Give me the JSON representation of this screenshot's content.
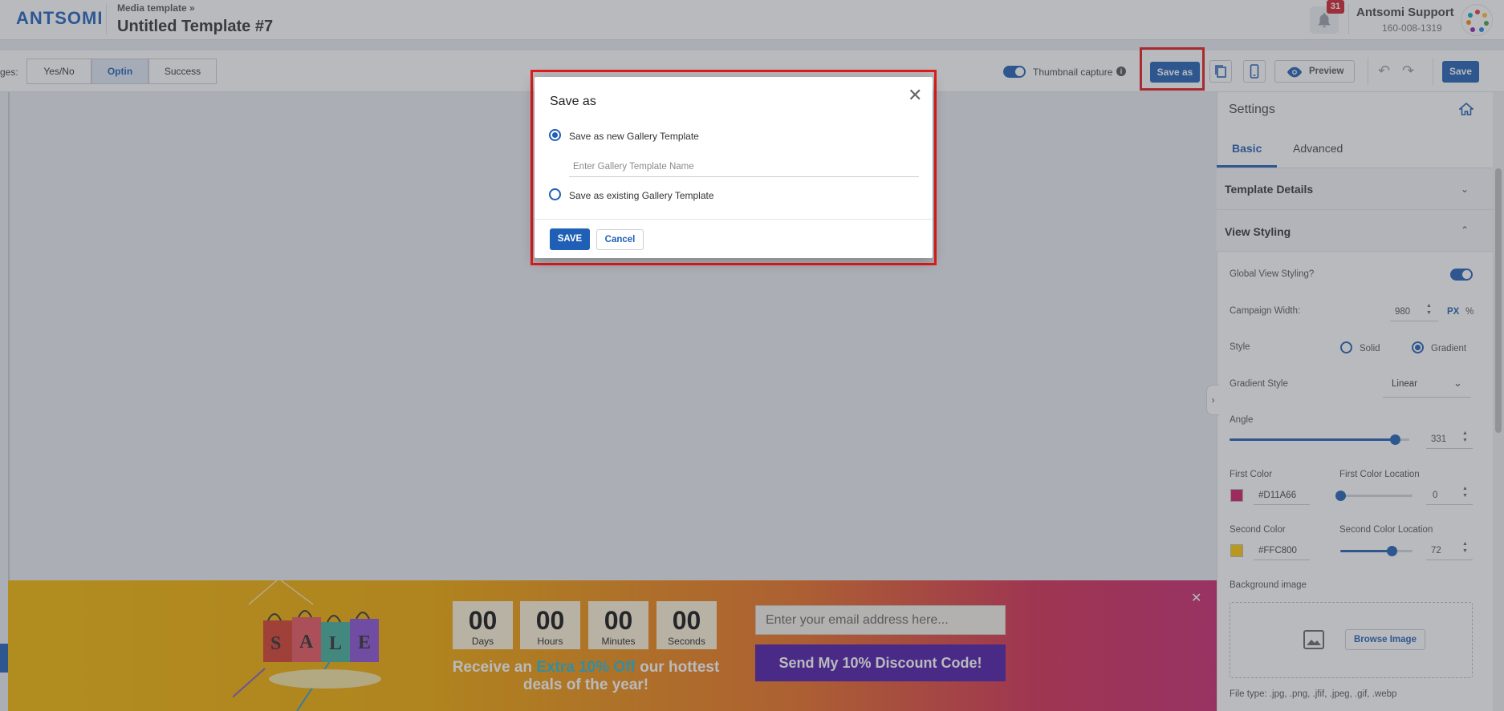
{
  "header": {
    "logo": "ANTSOMI",
    "breadcrumb": "Media template »",
    "title": "Untitled Template #7",
    "notification_count": "31",
    "user_name": "Antsomi Support",
    "user_id": "160-008-1319"
  },
  "toolbar": {
    "pages_label": "ges:",
    "pages": [
      "Yes/No",
      "Optin",
      "Success"
    ],
    "active_page": "Optin",
    "thumbnail_label": "Thumbnail capture",
    "save_as_label": "Save as",
    "preview_label": "Preview",
    "save_label": "Save"
  },
  "modal": {
    "title": "Save as",
    "option_new": "Save as new Gallery Template",
    "name_placeholder": "Enter Gallery Template Name",
    "option_existing": "Save as existing Gallery Template",
    "save_button": "SAVE",
    "cancel_button": "Cancel"
  },
  "banner": {
    "bag_letters": [
      "S",
      "A",
      "L",
      "E"
    ],
    "countdown": [
      {
        "value": "00",
        "unit": "Days"
      },
      {
        "value": "00",
        "unit": "Hours"
      },
      {
        "value": "00",
        "unit": "Minutes"
      },
      {
        "value": "00",
        "unit": "Seconds"
      }
    ],
    "promo_prefix": "Receive an",
    "promo_highlight": "Extra 10% Off",
    "promo_suffix": "our hottest deals of the year!",
    "email_placeholder": "Enter your email address here...",
    "cta": "Send My 10% Discount Code!"
  },
  "settings": {
    "title": "Settings",
    "tabs": [
      "Basic",
      "Advanced"
    ],
    "active_tab": "Basic",
    "sections": {
      "template_details": "Template Details",
      "view_styling": "View Styling"
    },
    "global_view_styling_label": "Global View Styling?",
    "campaign_width_label": "Campaign Width:",
    "campaign_width_value": "980",
    "unit_px": "PX",
    "unit_percent": "%",
    "style_label": "Style",
    "style_options": [
      "Solid",
      "Gradient"
    ],
    "style_selected": "Gradient",
    "gradient_style_label": "Gradient Style",
    "gradient_style_value": "Linear",
    "angle_label": "Angle",
    "angle_value": "331",
    "angle_fraction": 0.919,
    "first_color_label": "First Color",
    "first_color_hex": "#D11A66",
    "first_color_location_label": "First Color Location",
    "first_color_location": "0",
    "second_color_label": "Second Color",
    "second_color_hex": "#FFC800",
    "second_color_location_label": "Second Color Location",
    "second_color_location": "72",
    "background_image_label": "Background image",
    "browse_label": "Browse Image",
    "file_type_text": "File type: .jpg, .png, .jfif, .jpeg, .gif, .webp"
  },
  "colors": {
    "brand": "#1f5fb5",
    "highlight_box": "#e21b1b",
    "badge": "#d21f2e",
    "cta": "#4b18a8",
    "first_color": "#D11A66",
    "second_color": "#FFC800"
  }
}
